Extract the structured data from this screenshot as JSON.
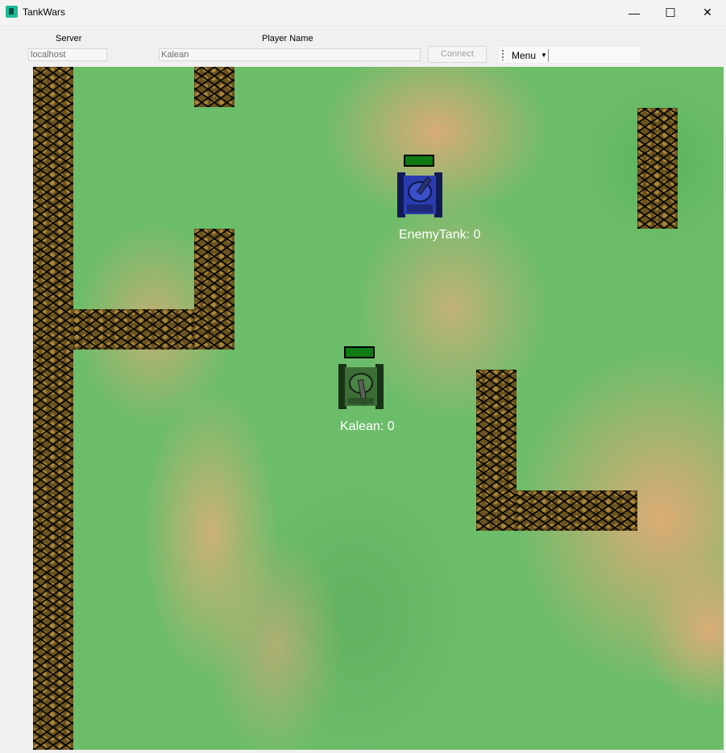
{
  "window": {
    "title": "TankWars",
    "minimize_glyph": "—",
    "maximize_glyph": "☐",
    "close_glyph": "✕"
  },
  "toolbar": {
    "server_label": "Server",
    "server_value": "localhost",
    "player_label": "Player Name",
    "player_value": "Kalean",
    "connect_label": "Connect",
    "menu_label": "Menu"
  },
  "tanks": [
    {
      "name": "EnemyTank",
      "label": "EnemyTank: 0",
      "score": 0,
      "color": "#1d2d9a",
      "health": 1.0
    },
    {
      "name": "Kalean",
      "label": "Kalean: 0",
      "score": 0,
      "color": "#2f6a2a",
      "health": 1.0
    }
  ],
  "colors": {
    "health_bar": "#0f7a14",
    "terrain_green": "#6cbd6a",
    "terrain_sand": "#d9ae78",
    "wall": "#6b5320"
  }
}
